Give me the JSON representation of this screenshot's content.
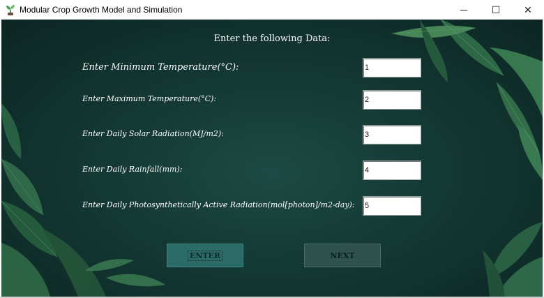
{
  "window": {
    "title": "Modular Crop Growth Model and Simulation",
    "controls": {
      "minimize": "─",
      "maximize": "☐",
      "close": "✕"
    }
  },
  "form": {
    "heading": "Enter the following Data:",
    "fields": [
      {
        "label": "Enter Minimum Temperature(°C):",
        "value": "1"
      },
      {
        "label": "Enter Maximum Temperature(°C):",
        "value": "2"
      },
      {
        "label": "Enter Daily Solar Radiation(MJ/m2):",
        "value": "3"
      },
      {
        "label": "Enter Daily Rainfall(mm):",
        "value": "4"
      },
      {
        "label": "Enter Daily Photosynthetically Active Radiation(mol[photon]/m2-day):",
        "value": "5"
      }
    ],
    "enter_button": "ENTER",
    "next_button": "NEXT"
  },
  "colors": {
    "background": "#163c37",
    "enter_button": "#2a6b68",
    "next_button": "#2f524f",
    "leaf": "#2f6e4e"
  }
}
